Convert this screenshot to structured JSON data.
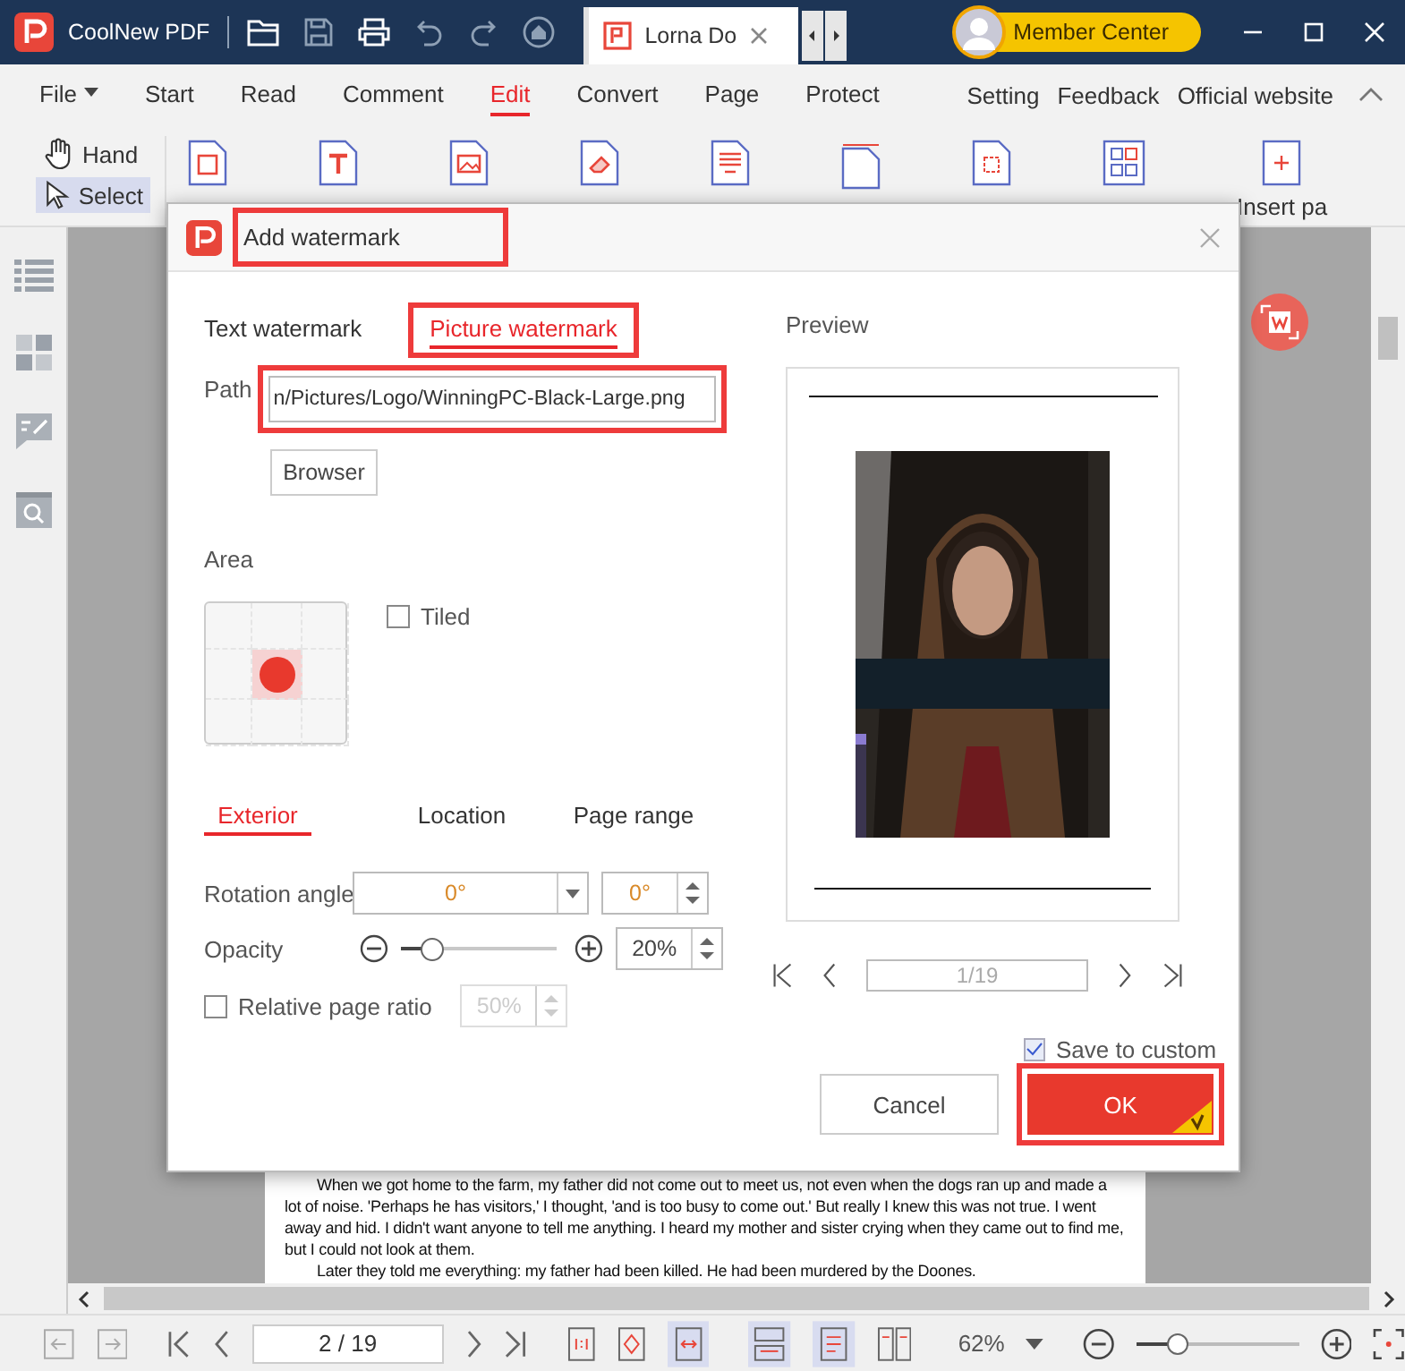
{
  "app": {
    "name": "CoolNew PDF"
  },
  "document_tab": {
    "title": "Lorna Do"
  },
  "member": {
    "label": "Member Center"
  },
  "menu": [
    {
      "label": "File",
      "selected": false
    },
    {
      "label": "Start",
      "selected": false
    },
    {
      "label": "Read",
      "selected": false
    },
    {
      "label": "Comment",
      "selected": false
    },
    {
      "label": "Edit",
      "selected": true
    },
    {
      "label": "Convert",
      "selected": false
    },
    {
      "label": "Page",
      "selected": false
    },
    {
      "label": "Protect",
      "selected": false
    }
  ],
  "menu_right": [
    "Setting",
    "Feedback",
    "Official website"
  ],
  "tools": [
    {
      "label": "Hand",
      "selected": false
    },
    {
      "label": "Select",
      "selected": true
    }
  ],
  "ribbon_last_label": "Insert pa",
  "document": {
    "paragraphs": [
      "When we got home to the farm, my father did not come out to meet us, not even when the dogs ran up and made a lot of noise. 'Perhaps he has visitors,' I thought, 'and is too busy to come out.' But really I knew this was not true. I went away and hid. I didn't want anyone to tell me anything. I heard my mother and sister crying when they came out to find me, but I could not look at them.",
      "Later they told me everything: my father had been killed. He had been murdered by the Doones."
    ]
  },
  "dialog": {
    "title": "Add watermark",
    "highlighted": true,
    "tabs": [
      {
        "label": "Text watermark",
        "selected": false,
        "highlighted": false
      },
      {
        "label": "Picture watermark",
        "selected": true,
        "highlighted": true
      }
    ],
    "path": {
      "label": "Path",
      "value": "n/Pictures/Logo/WinningPC-Black-Large.png",
      "highlighted": true
    },
    "browse_button": "Browser",
    "area": {
      "label": "Area",
      "cells": [
        {
          "selected": false
        },
        {
          "selected": false
        },
        {
          "selected": false
        },
        {
          "selected": false
        },
        {
          "selected": true
        },
        {
          "selected": false
        },
        {
          "selected": false
        },
        {
          "selected": false
        },
        {
          "selected": false
        }
      ],
      "tiled": {
        "label": "Tiled",
        "checked": false
      }
    },
    "subtabs": [
      {
        "label": "Exterior",
        "selected": true
      },
      {
        "label": "Location",
        "selected": false
      },
      {
        "label": "Page range",
        "selected": false
      }
    ],
    "rotation": {
      "label": "Rotation angle",
      "value": "0°",
      "spin_value": "0°"
    },
    "opacity": {
      "label": "Opacity",
      "level": 0.2,
      "value": "20%"
    },
    "relative": {
      "label": "Relative page ratio",
      "checked": false,
      "value": "50%",
      "disabled": true
    },
    "preview": {
      "label": "Preview",
      "page": "1/19"
    },
    "save_custom": {
      "label": "Save to custom",
      "checked": true
    },
    "buttons": [
      {
        "label": "Cancel",
        "kind": "secondary",
        "highlighted": false
      },
      {
        "label": "OK",
        "kind": "primary",
        "highlighted": true
      }
    ]
  },
  "status_bar": {
    "page": "2 / 19",
    "zoom": "62%",
    "zoom_slider": {
      "level": 0.25
    }
  }
}
